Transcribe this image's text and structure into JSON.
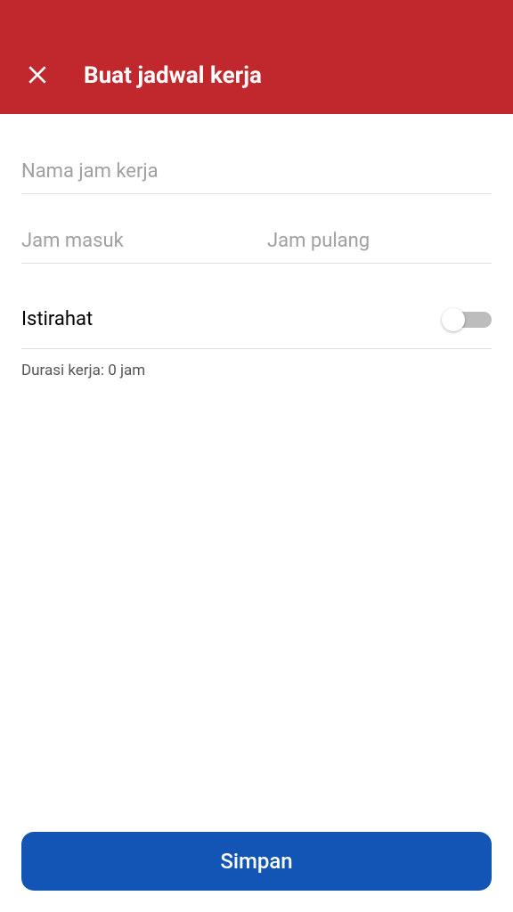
{
  "header": {
    "title": "Buat jadwal kerja"
  },
  "form": {
    "nameField": {
      "placeholder": "Nama jam kerja",
      "value": ""
    },
    "startField": {
      "placeholder": "Jam masuk",
      "value": ""
    },
    "endField": {
      "placeholder": "Jam pulang",
      "value": ""
    },
    "breakToggle": {
      "label": "Istirahat",
      "value": false
    },
    "durationText": "Durasi kerja: 0 jam"
  },
  "footer": {
    "saveLabel": "Simpan"
  }
}
